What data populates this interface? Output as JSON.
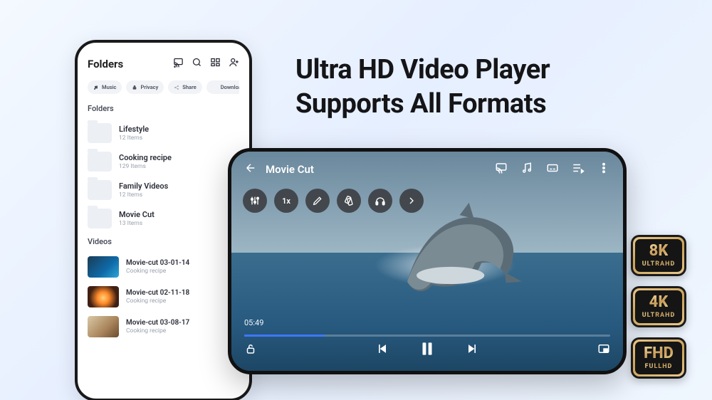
{
  "headline": {
    "line1": "Ultra HD Video Player",
    "line2": "Supports All Formats"
  },
  "phone": {
    "title": "Folders",
    "toolbar_icons": [
      "cast-icon",
      "search-icon",
      "view-icon",
      "profile-icon"
    ],
    "chips": [
      {
        "icon": "music",
        "label": "Music"
      },
      {
        "icon": "lock",
        "label": "Privacy"
      },
      {
        "icon": "share",
        "label": "Share"
      },
      {
        "icon": "download",
        "label": "Downloads"
      }
    ],
    "folders_heading": "Folders",
    "folders": [
      {
        "name": "Lifestyle",
        "sub": "12 Items"
      },
      {
        "name": "Cooking recipe",
        "sub": "129 Items"
      },
      {
        "name": "Family Videos",
        "sub": "12 Items"
      },
      {
        "name": "Movie Cut",
        "sub": "13 Items"
      }
    ],
    "videos_heading": "Videos",
    "videos": [
      {
        "name": "Movie-cut 03-01-14",
        "sub": "Cooking recipe",
        "thumb": "vt1"
      },
      {
        "name": "Movie-cut 02-11-18",
        "sub": "Cooking recipe",
        "thumb": "vt2"
      },
      {
        "name": "Movie-cut 03-08-17",
        "sub": "Cooking recipe",
        "thumb": "vt3"
      }
    ]
  },
  "player": {
    "title": "Movie Cut",
    "elapsed": "05:49",
    "progress_pct": 22,
    "speed_label": "1x"
  },
  "badges": [
    {
      "main": "8K",
      "sub": "ULTRAHD"
    },
    {
      "main": "4K",
      "sub": "ULTRAHD"
    },
    {
      "main": "FHD",
      "sub": "FULLHD"
    }
  ]
}
